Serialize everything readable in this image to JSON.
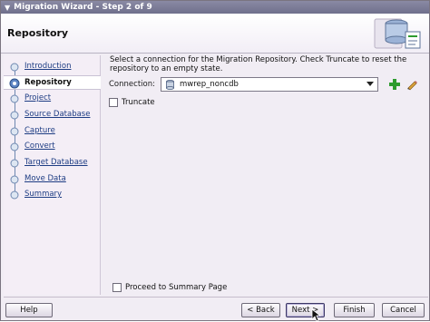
{
  "window": {
    "title": "Migration Wizard - Step 2 of 9"
  },
  "header": {
    "title": "Repository"
  },
  "nav": {
    "items": [
      {
        "label": "Introduction",
        "active": false
      },
      {
        "label": "Repository",
        "active": true
      },
      {
        "label": "Project",
        "active": false
      },
      {
        "label": "Source Database",
        "active": false
      },
      {
        "label": "Capture",
        "active": false
      },
      {
        "label": "Convert",
        "active": false
      },
      {
        "label": "Target Database",
        "active": false
      },
      {
        "label": "Move Data",
        "active": false
      },
      {
        "label": "Summary",
        "active": false
      }
    ]
  },
  "main": {
    "instructions": "Select a connection for the Migration Repository.  Check Truncate to reset the repository to an empty state.",
    "connection_label": "Connection:",
    "connection_value": "mwrep_noncdb",
    "truncate_label": "Truncate",
    "truncate_checked": false,
    "proceed_label": "Proceed to Summary Page",
    "proceed_checked": false
  },
  "buttons": {
    "help": "Help",
    "back": "< Back",
    "next": "Next >",
    "finish": "Finish",
    "cancel": "Cancel"
  },
  "colors": {
    "titlebar": "#7c7c98",
    "link": "#1d3c83",
    "panel_bg": "#f1edf4",
    "add_icon": "#2e9b2e"
  },
  "icons": {
    "window_menu": "triangle-down-icon",
    "header": "database-wizard-icon",
    "connection": "database-icon",
    "add": "plus-icon",
    "edit": "pencil-icon",
    "cursor": "mouse-pointer-icon"
  }
}
